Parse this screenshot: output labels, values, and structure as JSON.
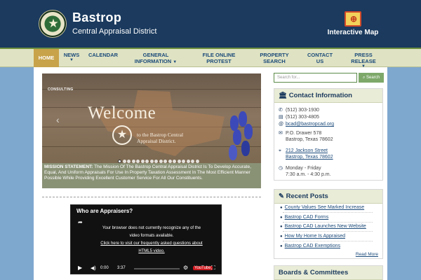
{
  "header": {
    "title": "Bastrop",
    "subtitle": "Central Appraisal District",
    "map_link": "Interactive Map"
  },
  "nav": {
    "items": [
      {
        "label": "HOME",
        "active": true
      },
      {
        "label": "NEWS",
        "dropdown": true
      },
      {
        "label": "CALENDAR"
      },
      {
        "label": "GENERAL INFORMATION",
        "dropdown": true
      },
      {
        "label": "FILE ONLINE PROTEST"
      },
      {
        "label": "PROPERTY SEARCH"
      },
      {
        "label": "CONTACT US"
      },
      {
        "label": "PRESS RELEASE",
        "dropdown": true
      }
    ]
  },
  "slider": {
    "brand_tag": "CONSULTING",
    "headline": "Welcome",
    "caption_line1": "to the Bastrop Central",
    "caption_line2": "Appraisal District.",
    "slide_count": 18,
    "active_slide": 1
  },
  "mission": {
    "label": "MISSION STATEMENT:",
    "text": "The Mission Of The Bastrop Central Appraisal District Is To Develop Accurate, Equal, And Uniform Appraisals For Use In Property Taxation Assessment In The Most Efficient Manner Possible While Providing Excellent Customer Service For All Our Constituents."
  },
  "video": {
    "title": "Who are Appraisers?",
    "message_line1": "Your browser does not currently recognize any of the",
    "message_line2": "video formats available.",
    "message_line3": "Click here to visit our frequently asked questions about",
    "message_line4": "HTML5 video.",
    "time_current": "0:00",
    "time_total": "3:37",
    "youtube_label": "YouTube"
  },
  "search": {
    "placeholder": "Search for...",
    "button_label": "Search"
  },
  "contact": {
    "title": "Contact Information",
    "phone": "(512) 303-1930",
    "fax": "(512) 303-4805",
    "email": "bcad@bastropcad.org",
    "po_line1": "P.O. Drawer 578",
    "po_line2": "Bastrop, Texas 78602",
    "street_line1": "212 Jackson Street",
    "street_line2": "Bastrop, Texas 78602",
    "hours_line1": "Monday - Friday",
    "hours_line2": "7:30 a.m. - 4:30 p.m."
  },
  "recent_posts": {
    "title": "Recent Posts",
    "items": [
      "County Values See Marked Increase",
      "Bastrop CAD Forms",
      "Bastrop CAD Launches New Website",
      "How My Home Is Appraised",
      "Bastrop CAD Exemptions"
    ],
    "read_more": "Read More"
  },
  "boards": {
    "title": "Boards & Committees"
  },
  "colors": {
    "header_bg": "#1b3a5e",
    "nav_bg": "#dfe3c3",
    "nav_active": "#c8a34a",
    "accent_green": "#7da86a"
  }
}
